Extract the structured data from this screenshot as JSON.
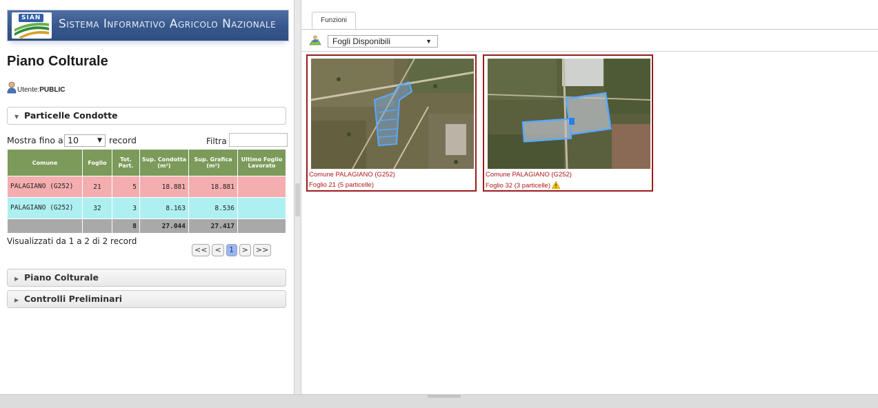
{
  "banner": {
    "logo_text": "SIAN",
    "title": "Sistema Informativo Agricolo Nazionale"
  },
  "page": {
    "title": "Piano Colturale"
  },
  "user": {
    "label": "Utente:",
    "name": "PUBLIC"
  },
  "sections": {
    "particelle": "Particelle Condotte",
    "piano": "Piano Colturale",
    "controlli": "Controlli Preliminari"
  },
  "table_controls": {
    "show_prefix": "Mostra fino a",
    "page_size": "10",
    "show_suffix": "record",
    "filter_label": "Filtra",
    "filter_value": ""
  },
  "table": {
    "headers": [
      "Comune",
      "Foglio",
      "Tot. Part.",
      "Sup. Condotta (m²)",
      "Sup. Grafica (m²)",
      "Ultimo Foglio Lavorato"
    ],
    "rows": [
      {
        "comune": "PALAGIANO (G252)",
        "foglio": "21",
        "tot_part": "5",
        "sup_condotta": "18.881",
        "sup_grafica": "18.881",
        "ultimo": ""
      },
      {
        "comune": "PALAGIANO (G252)",
        "foglio": "32",
        "tot_part": "3",
        "sup_condotta": "8.163",
        "sup_grafica": "8.536",
        "ultimo": ""
      }
    ],
    "totals": {
      "tot_part": "8",
      "sup_condotta": "27.044",
      "sup_grafica": "27.417"
    }
  },
  "table_info": "Visualizzati da 1 a 2 di 2 record",
  "pager": {
    "first": "<<",
    "prev": "<",
    "current": "1",
    "next": ">",
    "last": ">>"
  },
  "right": {
    "tab_label": "Funzioni",
    "dropdown_value": "Fogli Disponibili",
    "cards": [
      {
        "line1": "Comune PALAGIANO (G252)",
        "line2": "Foglio 21 (5 particelle)",
        "warning": false
      },
      {
        "line1": "Comune PALAGIANO (G252)",
        "line2": "Foglio 32 (3 particelle)",
        "warning": true
      }
    ]
  },
  "colors": {
    "header_green": "#7c9a5a",
    "row_red": "#f4aeb0",
    "row_cyan": "#aef0f2",
    "card_border": "#9b1b1b"
  }
}
